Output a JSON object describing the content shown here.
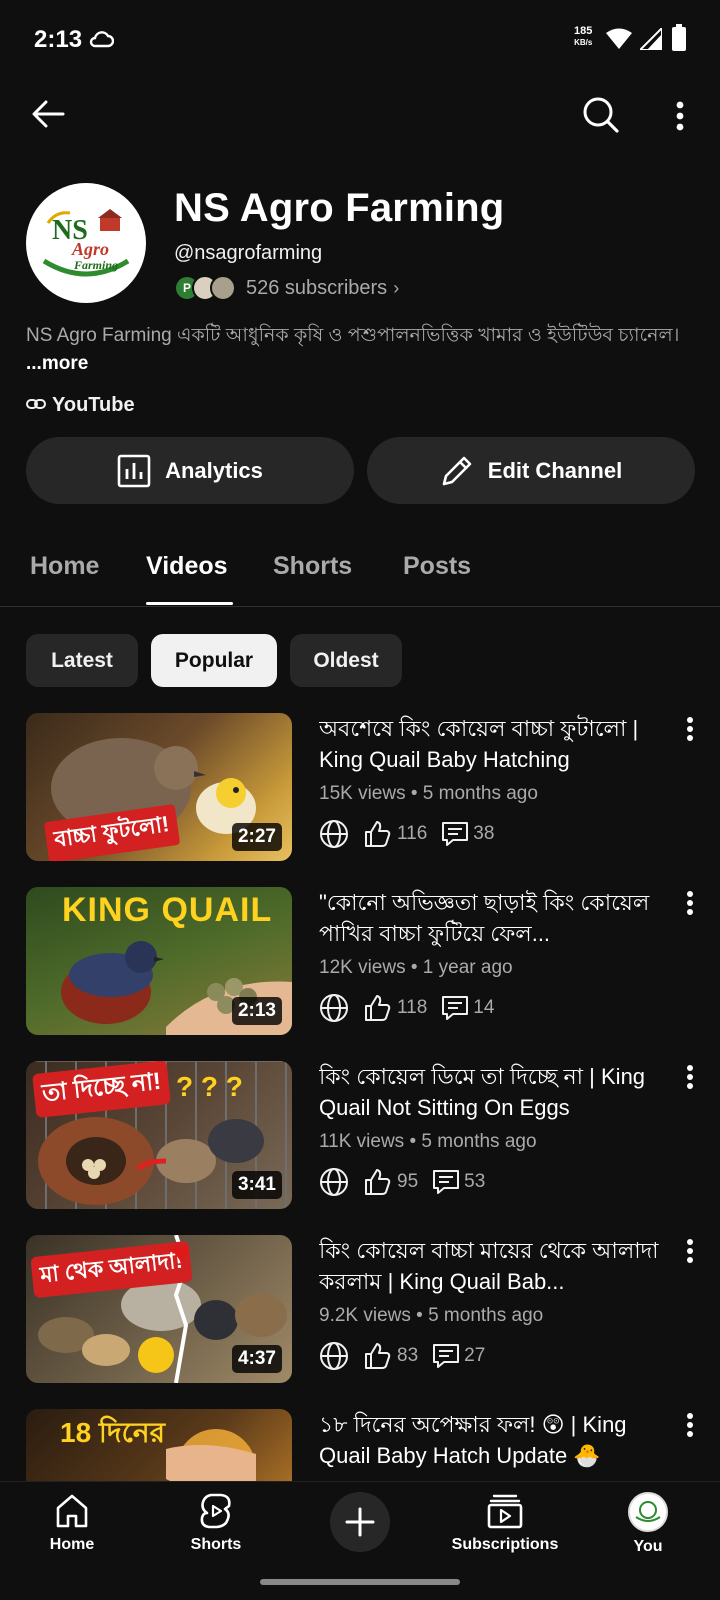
{
  "status_bar": {
    "time": "2:13",
    "net_speed_value": "185",
    "net_speed_unit": "KB/s"
  },
  "top_bar": {
    "back_icon": "back-arrow-icon",
    "search_icon": "search-icon",
    "more_icon": "more-vertical-icon"
  },
  "channel": {
    "name": "NS Agro Farming",
    "handle": "@nsagrofarming",
    "subscribers": "526 subscribers",
    "subscriber_avatar_initial": "P",
    "description": "NS Agro Farming একটি আধুনিক কৃষি ও পশুপালনভিত্তিক খামার ও ইউটিউব চ্যানেল।",
    "more_label": "...more",
    "link_label": "YouTube",
    "analytics_label": "Analytics",
    "edit_label": "Edit Channel",
    "logo_text_top": "NS",
    "logo_text_mid": "Agro",
    "logo_text_bottom": "Farming"
  },
  "tabs": [
    "Home",
    "Videos",
    "Shorts",
    "Posts"
  ],
  "active_tab": "Videos",
  "chips": [
    "Latest",
    "Popular",
    "Oldest"
  ],
  "active_chip": "Popular",
  "videos": [
    {
      "title": "অবশেষে কিং কোয়েল বাচ্চা ফুটালো | King Quail Baby Hatching",
      "meta": "15K views • 5 months ago",
      "likes": "116",
      "comments": "38",
      "duration": "2:27",
      "thumb_caption": "বাচ্চা ফুটলো!"
    },
    {
      "title": "\"কোনো অভিজ্ঞতা ছাড়াই কিং কোয়েল পাখির বাচ্চা ফুটিয়ে ফেল...",
      "meta": "12K views • 1 year ago",
      "likes": "118",
      "comments": "14",
      "duration": "2:13",
      "thumb_caption": "KING QUAIL"
    },
    {
      "title": "কিং কোয়েল ডিমে তা দিচ্ছে না | King Quail Not Sitting On Eggs",
      "meta": "11K views • 5 months ago",
      "likes": "95",
      "comments": "53",
      "duration": "3:41",
      "thumb_caption": "তা দিচ্ছে না!"
    },
    {
      "title": "কিং কোয়েল বাচ্চা মায়ের থেকে আলাদা করলাম | King Quail Bab...",
      "meta": "9.2K views • 5 months ago",
      "likes": "83",
      "comments": "27",
      "duration": "4:37",
      "thumb_caption": "মা থেক আলাদা!"
    },
    {
      "title": "১৮ দিনের অপেক্ষার ফল! 😲 | King Quail Baby Hatch Update 🐣",
      "meta": "",
      "likes": "",
      "comments": "",
      "duration": "",
      "thumb_caption": "18 দিনের"
    }
  ],
  "bottom_nav": {
    "home": "Home",
    "shorts": "Shorts",
    "subscriptions": "Subscriptions",
    "you": "You"
  },
  "colors": {
    "background": "#0f0f0f",
    "surface": "#272727",
    "text_primary": "#f1f1f1",
    "text_secondary": "#aaaaaa",
    "logo_green": "#2e8b2e"
  }
}
